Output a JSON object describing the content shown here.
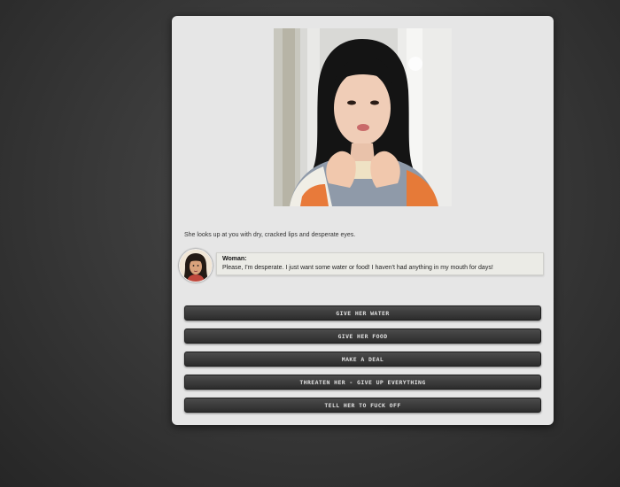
{
  "scene": {
    "narration": "She looks up at you with dry, cracked lips and desperate eyes."
  },
  "dialogue": {
    "speaker": "Woman:",
    "text": "Please, I'm desperate. I just want some water or food! I haven't had anything in my mouth for days!"
  },
  "choices": [
    {
      "label": "GIVE HER WATER"
    },
    {
      "label": "GIVE HER FOOD"
    },
    {
      "label": "MAKE A DEAL"
    },
    {
      "label": "THREATEN HER - GIVE UP EVERYTHING"
    },
    {
      "label": "TELL HER TO FUCK OFF"
    }
  ],
  "colors": {
    "panel": "#e6e6e6",
    "button": "#3a3a3a",
    "button_text": "#e0e0e0"
  }
}
